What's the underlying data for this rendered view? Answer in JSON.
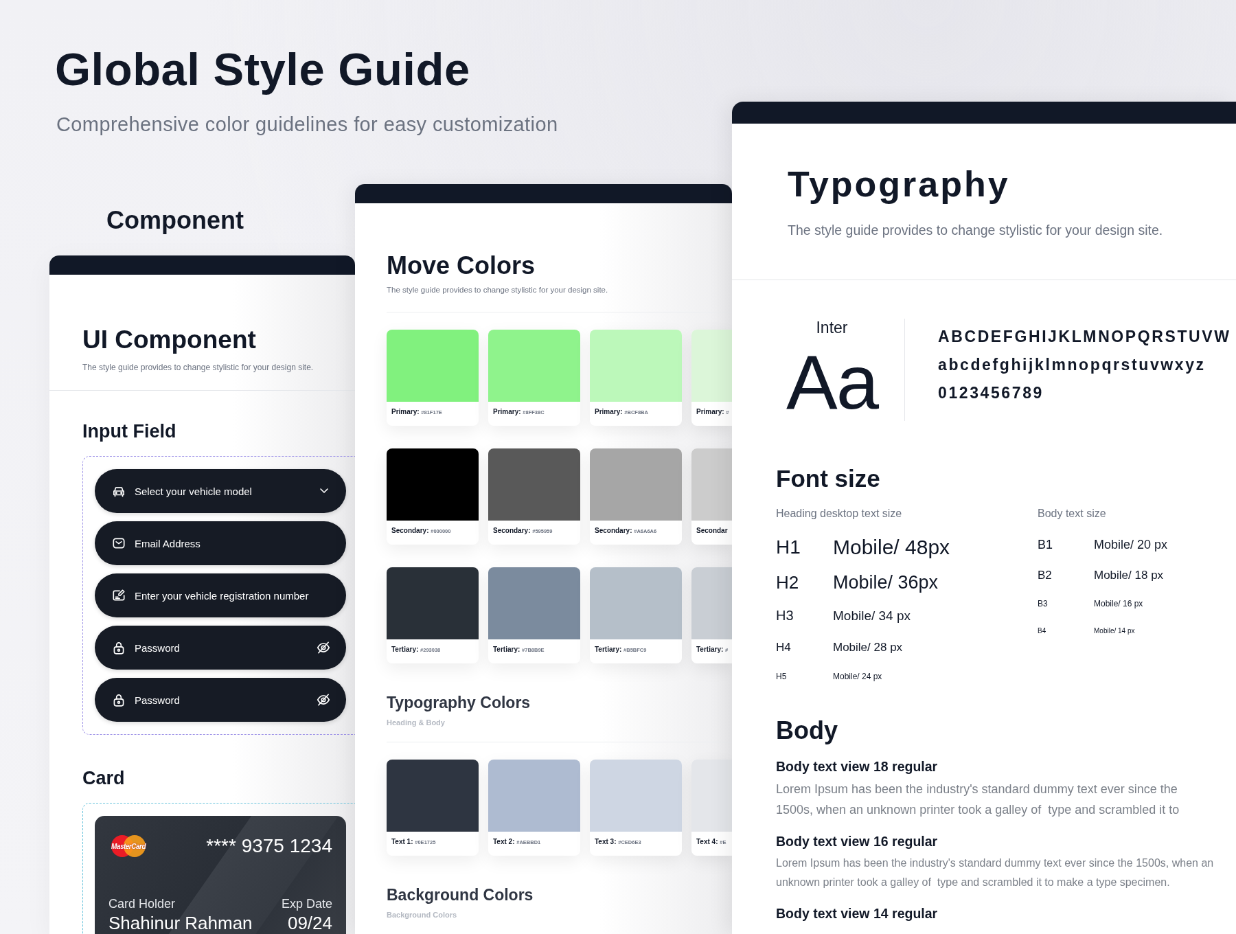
{
  "header": {
    "title": "Global Style Guide",
    "subtitle": "Comprehensive color guidelines for easy customization"
  },
  "component_label": "Component",
  "ui_panel": {
    "title": "UI Component",
    "subtitle": "The style guide provides to change stylistic for your design site.",
    "input_heading": "Input Field",
    "fields": [
      {
        "kind": "select",
        "placeholder": "Select your vehicle model"
      },
      {
        "kind": "email",
        "placeholder": "Email Address"
      },
      {
        "kind": "text",
        "placeholder": "Enter your vehicle registration number"
      },
      {
        "kind": "password",
        "placeholder": "Password"
      },
      {
        "kind": "password",
        "placeholder": "Password"
      }
    ],
    "card_heading": "Card",
    "card": {
      "brand": "MasterCard",
      "number": "**** 9375 1234",
      "holder_label": "Card Holder",
      "holder": "Shahinur Rahman",
      "exp_label": "Exp Date",
      "exp": "09/24"
    }
  },
  "colors_panel": {
    "title": "Move Colors",
    "subtitle": "The style guide provides to change stylistic for your design site.",
    "swatch_rows": [
      [
        {
          "label": "Primary:",
          "code": "#81F17E",
          "color": "#81f17e"
        },
        {
          "label": "Primary:",
          "code": "#8FF38C",
          "color": "#8ff38c"
        },
        {
          "label": "Primary:",
          "code": "#BCF8BA",
          "color": "#bcf8ba"
        },
        {
          "label": "Primary:",
          "code": "#",
          "color": "#dcf6d9"
        }
      ],
      [
        {
          "label": "Secondary:",
          "code": "#000000",
          "color": "#000000"
        },
        {
          "label": "Secondary:",
          "code": "#595959",
          "color": "#595959"
        },
        {
          "label": "Secondary:",
          "code": "#A6A6A6",
          "color": "#a6a6a6"
        },
        {
          "label": "Secondar",
          "color": "#cccccc"
        }
      ],
      [
        {
          "label": "Tertiary:",
          "code": "#293038",
          "color": "#293038"
        },
        {
          "label": "Tertiary:",
          "code": "#7B8B9E",
          "color": "#7b8b9e"
        },
        {
          "label": "Tertiary:",
          "code": "#B5BFC9",
          "color": "#b5bfc9"
        },
        {
          "label": "Tertiary:",
          "code": "#",
          "color": "#c9ced4"
        }
      ]
    ],
    "typography_heading": "Typography Colors",
    "typography_note": "Heading & Body",
    "text_swatches": [
      {
        "label": "Text 1:",
        "code": "#0E1725",
        "color": "#2e3541"
      },
      {
        "label": "Text 2:",
        "code": "#AEBBD1",
        "color": "#aebbd1"
      },
      {
        "label": "Text 3:",
        "code": "#CED6E3",
        "color": "#ced6e3"
      },
      {
        "label": "Text 4:",
        "code": "#E",
        "color": "#e4e6ea"
      }
    ],
    "background_heading": "Background Colors",
    "background_note": "Background Colors"
  },
  "typography_panel": {
    "title": "Typography",
    "subtitle": "The style guide provides to change stylistic for your design site.",
    "font_name": "Inter",
    "sample": "Aa",
    "glyph_lines": [
      "ABCDEFGHIJKLMNOPQRSTUVW",
      "abcdefghijklmnopqrstuvwxyz",
      "0123456789"
    ],
    "font_size_heading": "Font size",
    "heading_sizes_label": "Heading desktop text size",
    "body_sizes_label": "Body text size",
    "heading_sizes": [
      {
        "label": "H1",
        "value": "Mobile/ 48px"
      },
      {
        "label": "H2",
        "value": "Mobile/ 36px"
      },
      {
        "label": "H3",
        "value": "Mobile/ 34 px"
      },
      {
        "label": "H4",
        "value": "Mobile/ 28 px"
      },
      {
        "label": "H5",
        "value": "Mobile/ 24 px"
      }
    ],
    "body_sizes": [
      {
        "label": "B1",
        "value": "Mobile/ 20 px"
      },
      {
        "label": "B2",
        "value": "Mobile/ 18 px"
      },
      {
        "label": "B3",
        "value": "Mobile/ 16 px"
      },
      {
        "label": "B4",
        "value": "Mobile/ 14 px"
      }
    ],
    "body_heading": "Body",
    "body_samples": [
      {
        "title": "Body text view 18 regular",
        "text": "Lorem Ipsum has been the industry's standard dummy text ever since the 1500s, when an unknown printer took a galley of  type and scrambled it to"
      },
      {
        "title": "Body text view 16 regular",
        "text": "Lorem Ipsum has been the industry's standard dummy text ever since the 1500s, when an unknown printer took a galley of  type and scrambled it to make a type specimen."
      },
      {
        "title": "Body text view 14 regular"
      }
    ]
  }
}
